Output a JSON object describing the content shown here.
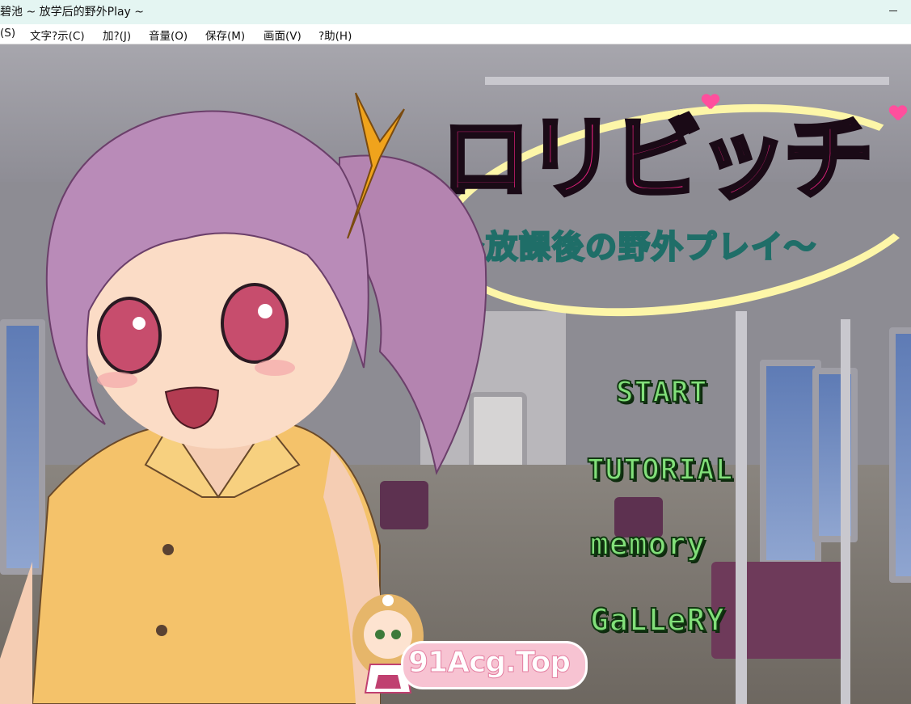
{
  "window": {
    "title": "碧池 ~ 放学后的野外Play ~",
    "minimize_icon": "minimize-icon"
  },
  "menubar": {
    "items": [
      "(S)",
      "文字?示(C)",
      "加?(J)",
      "音量(O)",
      "保存(M)",
      "画面(V)",
      "?助(H)"
    ]
  },
  "game": {
    "logo": {
      "title": "ロリビッチ",
      "subtitle": "〜放課後の野外プレイ〜"
    },
    "menu": {
      "start": "START",
      "tutorial": "TUTORIAL",
      "memory": "memory",
      "gallery": "GaLLeRY"
    },
    "watermark": "91Acg.Top",
    "colors": {
      "menu_text": "#82e07a",
      "logo_pink": "#e0207a",
      "logo_sub": "#d9f7ef",
      "swoosh": "#fdf6a8"
    }
  }
}
